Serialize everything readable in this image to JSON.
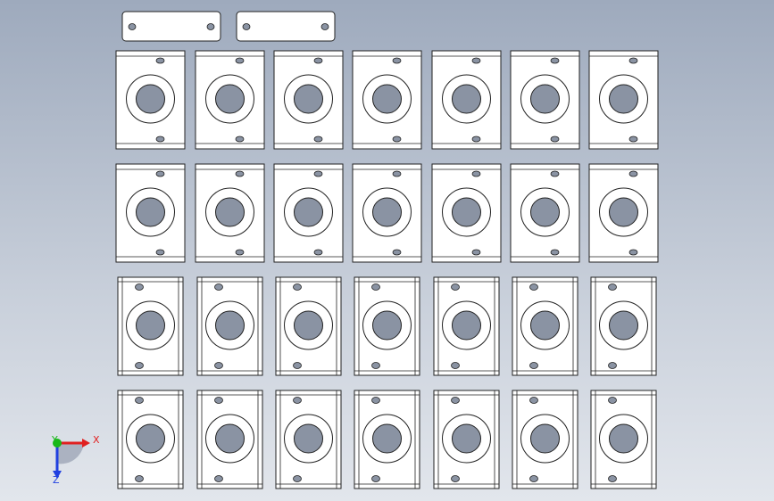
{
  "viewport": {
    "background_top": "#9eaabd",
    "background_bottom": "#e2e6ec",
    "part_fill": "#ffffff",
    "edge_color": "#222222",
    "hole_fill": "#8a93a3"
  },
  "scene": {
    "plates": [
      "top-plate-left",
      "top-plate-right"
    ],
    "bracket_rows": [
      {
        "style": "flat",
        "count": 7
      },
      {
        "style": "flat",
        "count": 7
      },
      {
        "style": "bent",
        "count": 7
      },
      {
        "style": "bent",
        "count": 7
      }
    ]
  },
  "triad": {
    "x_label": "X",
    "y_label": "Y",
    "z_label": "Z",
    "x_color": "#e02020",
    "y_color": "#18b818",
    "z_color": "#2040e0"
  }
}
